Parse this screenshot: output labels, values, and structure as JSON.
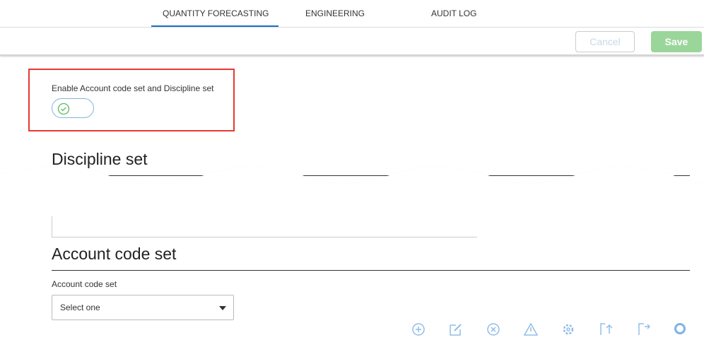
{
  "tabs": [
    {
      "label": "QUANTITY FORECASTING",
      "active": true
    },
    {
      "label": "ENGINEERING"
    },
    {
      "label": "AUDIT LOG"
    }
  ],
  "toolbar": {
    "cancel_label": "Cancel",
    "save_label": "Save"
  },
  "settings": {
    "enable_label": "Enable Account code set and Discipline set",
    "toggle_on": true
  },
  "discipline": {
    "title": "Discipline set"
  },
  "account": {
    "title": "Account code set",
    "field_label": "Account code set",
    "select_value": "Select one"
  },
  "colors": {
    "accent": "#1a6fc9",
    "save": "#9ad69a",
    "highlight": "#e53935",
    "icon": "#90bde8"
  },
  "action_icons": [
    "add-circle-icon",
    "edit-icon",
    "delete-circle-icon",
    "warning-icon",
    "settings-icon",
    "import-icon",
    "export-icon",
    "search-icon"
  ]
}
